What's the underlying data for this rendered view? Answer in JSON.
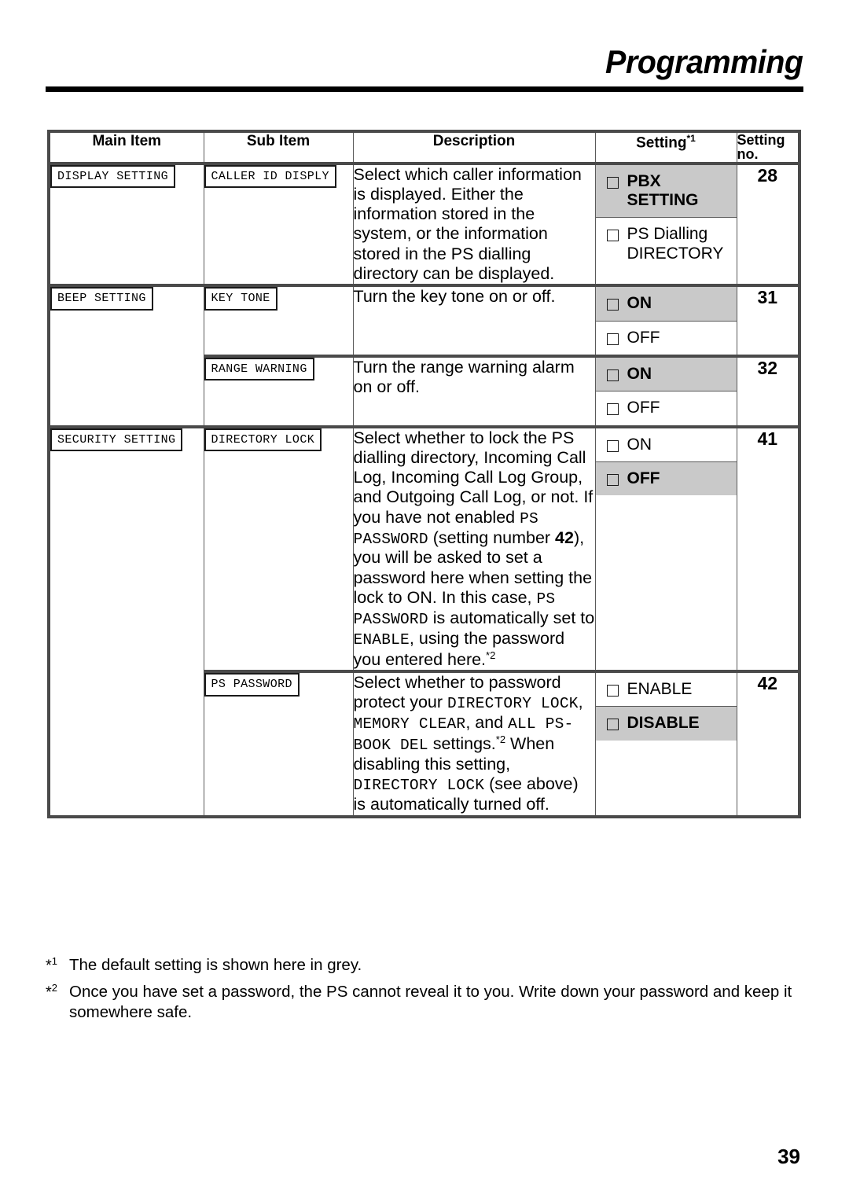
{
  "header": {
    "title": "Programming"
  },
  "table": {
    "columns": [
      "Main Item",
      "Sub Item",
      "Description",
      "Setting",
      "Setting no."
    ],
    "setting_header_label": "Setting",
    "setting_header_sup": "*1",
    "setting_no_header_line1": "Setting",
    "setting_no_header_line2": "no.",
    "rows": [
      {
        "main_item": "DISPLAY SETTING",
        "sub_item": "CALLER ID DISPLY",
        "description_parts": [
          {
            "text": "Select which caller information is displayed. Either the information stored in the system, or the information stored in the PS dialling directory can be displayed.",
            "style": "normal"
          }
        ],
        "options": [
          {
            "label_line1": "PBX",
            "label_line2": "SETTING",
            "default": true
          },
          {
            "label_line1": "PS Dialling",
            "label_line2": "DIRECTORY",
            "default": false
          }
        ],
        "setting_no": "28"
      },
      {
        "main_item": "BEEP SETTING",
        "sub_item": "KEY TONE",
        "description_parts": [
          {
            "text": "Turn the key tone on or off.",
            "style": "normal"
          }
        ],
        "options": [
          {
            "label_line1": "ON",
            "label_line2": "",
            "default": true
          },
          {
            "label_line1": "OFF",
            "label_line2": "",
            "default": false
          }
        ],
        "setting_no": "31"
      },
      {
        "main_item": "",
        "sub_item": "RANGE WARNING",
        "description_parts": [
          {
            "text": "Turn the range warning alarm on or off.",
            "style": "normal"
          }
        ],
        "options": [
          {
            "label_line1": "ON",
            "label_line2": "",
            "default": true
          },
          {
            "label_line1": "OFF",
            "label_line2": "",
            "default": false
          }
        ],
        "setting_no": "32"
      },
      {
        "main_item": "SECURITY SETTING",
        "sub_item": "DIRECTORY LOCK",
        "description_parts": [
          {
            "text": "Select whether to lock the PS dialling directory, Incoming Call Log, Incoming Call Log Group, and Outgoing Call Log, or not. If you have not enabled ",
            "style": "normal"
          },
          {
            "text": "PS PASSWORD",
            "style": "mono"
          },
          {
            "text": " (setting number ",
            "style": "normal"
          },
          {
            "text": "42",
            "style": "bold"
          },
          {
            "text": "), you will be asked to set a password here when setting the lock to ON. In this case, ",
            "style": "normal"
          },
          {
            "text": "PS  PASSWORD",
            "style": "mono"
          },
          {
            "text": " is automatically set to ",
            "style": "normal"
          },
          {
            "text": "ENABLE",
            "style": "mono"
          },
          {
            "text": ", using the password you entered here.",
            "style": "normal"
          },
          {
            "text": "*2",
            "style": "sup"
          }
        ],
        "options": [
          {
            "label_line1": "ON",
            "label_line2": "",
            "default": false
          },
          {
            "label_line1": "OFF",
            "label_line2": "",
            "default": true
          }
        ],
        "setting_no": "41"
      },
      {
        "main_item": "",
        "sub_item": "PS PASSWORD",
        "description_parts": [
          {
            "text": "Select whether to password protect your ",
            "style": "normal"
          },
          {
            "text": "DIRECTORY LOCK",
            "style": "mono"
          },
          {
            "text": ", ",
            "style": "normal"
          },
          {
            "text": "MEMORY CLEAR",
            "style": "mono"
          },
          {
            "text": ", and ",
            "style": "normal"
          },
          {
            "text": "ALL PS-BOOK DEL",
            "style": "mono"
          },
          {
            "text": " settings.",
            "style": "normal"
          },
          {
            "text": "*2",
            "style": "sup"
          },
          {
            "text": " When disabling this setting, ",
            "style": "normal"
          },
          {
            "text": "DIRECTORY LOCK",
            "style": "mono"
          },
          {
            "text": " (see above) is automatically turned off.",
            "style": "normal"
          }
        ],
        "options": [
          {
            "label_line1": "ENABLE",
            "label_line2": "",
            "default": false
          },
          {
            "label_line1": "DISABLE",
            "label_line2": "",
            "default": true
          }
        ],
        "setting_no": "42"
      }
    ]
  },
  "footnotes": [
    {
      "mark": "*1",
      "text": "The default setting is shown here in grey."
    },
    {
      "mark": "*2",
      "text": "Once you have set a password, the PS cannot reveal it to you. Write down your password and keep it somewhere safe."
    }
  ],
  "page_number": "39",
  "colors": {
    "default_highlight": "#c9c9c9",
    "rule": "#000000",
    "table_border": "#4a4a4a"
  }
}
